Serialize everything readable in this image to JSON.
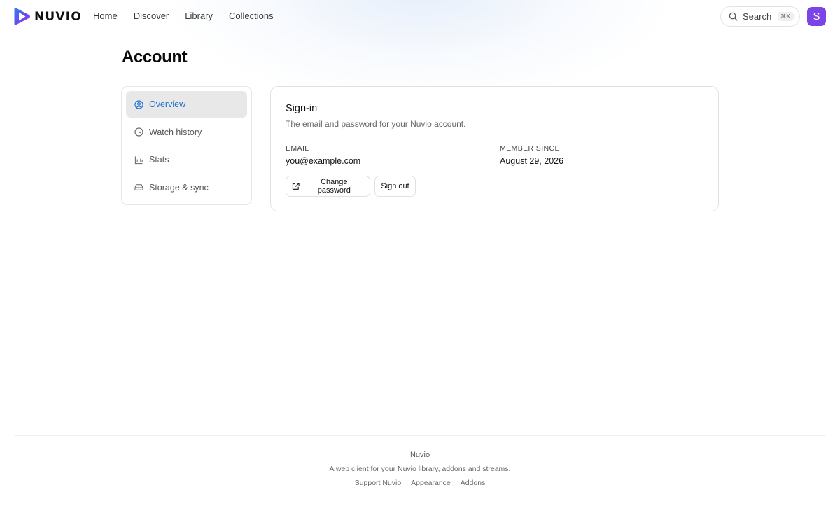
{
  "brand": {
    "name": "NUVIO",
    "accent": "#1f6fd1",
    "avatar_color": "#7c43e6"
  },
  "nav": {
    "items": [
      "Home",
      "Discover",
      "Library",
      "Collections"
    ]
  },
  "search": {
    "label": "Search",
    "shortcut": "⌘K",
    "icon": "search-icon"
  },
  "user": {
    "initial": "S"
  },
  "page": {
    "title": "Account"
  },
  "sidebar": {
    "items": [
      {
        "label": "Overview",
        "icon": "user-circle-icon",
        "active": true
      },
      {
        "label": "Watch history",
        "icon": "clock-icon",
        "active": false
      },
      {
        "label": "Stats",
        "icon": "bar-chart-icon",
        "active": false
      },
      {
        "label": "Storage & sync",
        "icon": "hard-drive-icon",
        "active": false
      }
    ]
  },
  "signin": {
    "title": "Sign-in",
    "subtitle": "The email and password for your Nuvio account.",
    "email_label": "EMAIL",
    "email_value": "you@example.com",
    "member_label": "MEMBER SINCE",
    "member_value": "August 29, 2026",
    "change_password": "Change password",
    "sign_out": "Sign out"
  },
  "footer": {
    "name": "Nuvio",
    "tagline": "A web client for your Nuvio library, addons and streams.",
    "links": [
      "Support Nuvio",
      "Appearance",
      "Addons"
    ]
  }
}
